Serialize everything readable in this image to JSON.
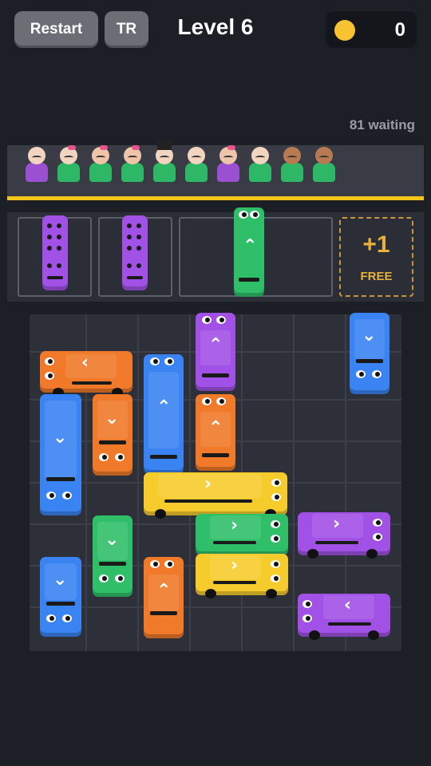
{
  "header": {
    "restart_label": "Restart",
    "tr_label": "TR",
    "level_text": "Level 6",
    "coins": "0"
  },
  "queue": {
    "waiting_text": "81 waiting",
    "people": [
      {
        "skin": "#f2d5c0",
        "shirt": "#9b4fd1",
        "accessory": "none"
      },
      {
        "skin": "#f2d5c0",
        "shirt": "#2eb865",
        "accessory": "bow"
      },
      {
        "skin": "#f0c4a8",
        "shirt": "#2eb865",
        "accessory": "bow"
      },
      {
        "skin": "#f0c4a8",
        "shirt": "#2eb865",
        "accessory": "bow"
      },
      {
        "skin": "#f2d5c0",
        "shirt": "#2eb865",
        "accessory": "hat"
      },
      {
        "skin": "#f2d5c0",
        "shirt": "#2eb865",
        "accessory": "none"
      },
      {
        "skin": "#f0c4a8",
        "shirt": "#9b4fd1",
        "accessory": "bow"
      },
      {
        "skin": "#f2d5c0",
        "shirt": "#2eb865",
        "accessory": "none"
      },
      {
        "skin": "#b87a52",
        "shirt": "#2eb865",
        "accessory": "none"
      },
      {
        "skin": "#b87a52",
        "shirt": "#2eb865",
        "accessory": "none"
      }
    ]
  },
  "parking": {
    "free_plus": "+1",
    "free_label": "FREE"
  },
  "colors": {
    "orange": "#f07a2a",
    "blue": "#3a83f2",
    "purple": "#a251e6",
    "green": "#2fbf69",
    "yellow": "#f6cc2c",
    "accent_line": "#f5c617",
    "coin": "#f7c331"
  }
}
